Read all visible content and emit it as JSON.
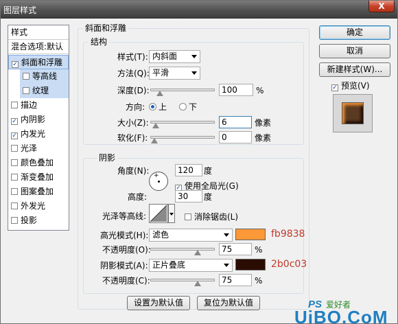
{
  "window": {
    "title": "图层样式",
    "close": "X"
  },
  "sidebar": {
    "items": [
      {
        "label": "样式",
        "type": "header"
      },
      {
        "label": "混合选项:默认",
        "type": "header"
      },
      {
        "label": "斜面和浮雕",
        "checked": true,
        "selected": true
      },
      {
        "label": "等高线",
        "checked": false,
        "sub": true
      },
      {
        "label": "纹理",
        "checked": false,
        "sub": true
      },
      {
        "label": "描边",
        "checked": false
      },
      {
        "label": "内阴影",
        "checked": true
      },
      {
        "label": "内发光",
        "checked": true
      },
      {
        "label": "光泽",
        "checked": false
      },
      {
        "label": "颜色叠加",
        "checked": false
      },
      {
        "label": "渐变叠加",
        "checked": false
      },
      {
        "label": "图案叠加",
        "checked": false
      },
      {
        "label": "外发光",
        "checked": false
      },
      {
        "label": "投影",
        "checked": false
      }
    ]
  },
  "bevel": {
    "group_title": "斜面和浮雕",
    "structure_title": "结构",
    "style_label": "样式(T):",
    "style_value": "内斜面",
    "method_label": "方法(Q):",
    "method_value": "平滑",
    "depth_label": "深度(D):",
    "depth_value": "100",
    "depth_unit": "%",
    "depth_fraction": 0.1,
    "direction_label": "方向:",
    "dir_up": "上",
    "dir_down": "下",
    "size_label": "大小(Z):",
    "size_value": "6",
    "size_unit": "像素",
    "size_fraction": 0.02,
    "soften_label": "软化(F):",
    "soften_value": "0",
    "soften_unit": "像素",
    "soften_fraction": 0.0
  },
  "shading": {
    "title": "阴影",
    "angle_label": "角度(N):",
    "angle_value": "120",
    "angle_unit": "度",
    "global_light_label": "使用全局光(G)",
    "global_light_checked": true,
    "altitude_label": "高度:",
    "altitude_value": "30",
    "altitude_unit": "度",
    "gloss_label": "光泽等高线:",
    "antialias_label": "消除锯齿(L)",
    "antialias_checked": false,
    "highlight_mode_label": "高光模式(H):",
    "highlight_mode_value": "滤色",
    "highlight_color": "#fb9838",
    "highlight_hex_note": "fb9838",
    "highlight_opacity_label": "不透明度(O):",
    "highlight_opacity_value": "75",
    "highlight_opacity_unit": "%",
    "highlight_opacity_fraction": 0.75,
    "shadow_mode_label": "阴影模式(A):",
    "shadow_mode_value": "正片叠底",
    "shadow_color": "#2b0c03",
    "shadow_hex_note": "2b0c03",
    "shadow_opacity_label": "不透明度(C):",
    "shadow_opacity_value": "75",
    "shadow_opacity_unit": "%",
    "shadow_opacity_fraction": 0.75
  },
  "buttons": {
    "ok": "确定",
    "cancel": "取消",
    "new_style": "新建样式(W)...",
    "preview": "预览(V)",
    "preview_checked": true,
    "set_default": "设置为默认值",
    "reset_default": "复位为默认值"
  },
  "watermark": {
    "text": "UiBQ.CoM",
    "ps_text": "PS",
    "cn_text": "爱好者"
  }
}
